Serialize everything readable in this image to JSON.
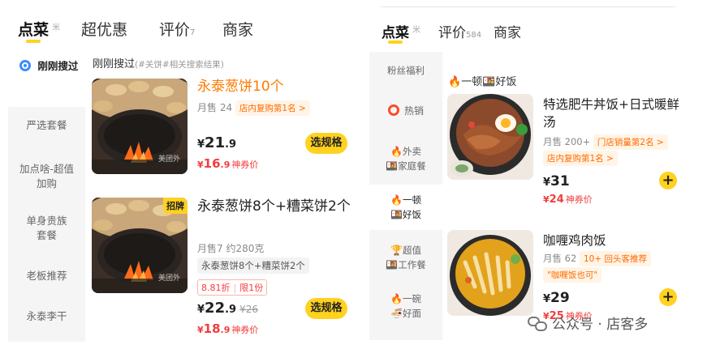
{
  "left": {
    "tabs": [
      {
        "label": "点菜",
        "sup": "米"
      },
      {
        "label": "超优惠"
      },
      {
        "label": "评价",
        "sub": "7"
      },
      {
        "label": "商家"
      }
    ],
    "sidebar": {
      "items": [
        {
          "label": "刚刚搜过",
          "icon": "search-icon"
        },
        {
          "label": "严选套餐"
        },
        {
          "label": "加点啥-超值加购"
        },
        {
          "label": "单身贵族套餐"
        },
        {
          "label": "老板推荐"
        },
        {
          "label": "永泰李干"
        }
      ]
    },
    "section_title": "刚刚搜过",
    "section_hint": "(#关饼#相关搜索结果)",
    "dishes": [
      {
        "title": "永泰葱饼10个",
        "sales": "月售 24",
        "rank_tag": "店内复购第1名 >",
        "price": "21",
        "price_dec": ".9",
        "coupon_price": "16",
        "coupon_dec": ".9",
        "coupon_label": "神券价",
        "button": "选规格",
        "watermark": "美团外"
      },
      {
        "badge": "招牌",
        "title": "永泰葱饼8个+糟菜饼2个",
        "sales": "月售7  约280克",
        "desc_tag": "永泰葱饼8个+糟菜饼2个",
        "discount": "8.81折",
        "limit": "限1份",
        "price": "22",
        "price_dec": ".9",
        "orig_price": "¥26",
        "coupon_price": "18",
        "coupon_dec": ".9",
        "coupon_label": "神券价",
        "button": "选规格",
        "watermark": "美团外"
      }
    ]
  },
  "right": {
    "tabs": [
      {
        "label": "点菜",
        "sup": "米"
      },
      {
        "label": "评价",
        "sub": "584"
      },
      {
        "label": "商家"
      }
    ],
    "sidebar": {
      "items": [
        {
          "label": "粉丝福利"
        },
        {
          "label": "热销",
          "icon": "fire-ring-icon"
        },
        {
          "label": "外卖家庭餐",
          "emoji1": "🔥",
          "emoji2": "🍱"
        },
        {
          "label": "一顿好饭",
          "emoji1": "🔥",
          "emoji2": "🍱"
        },
        {
          "label": "超值工作餐",
          "emoji1": "🏆",
          "emoji2": "🍱"
        },
        {
          "label": "一碗好面",
          "emoji1": "🔥",
          "emoji2": "🍜"
        }
      ]
    },
    "section_title": "一顿好饭",
    "section_emoji1": "🔥",
    "section_emoji2": "🍱",
    "dishes": [
      {
        "title": "特选肥牛丼饭+日式暖鲜汤",
        "sales": "月售 200+",
        "tag1": "门店销量第2名 >",
        "tag2": "店内复购第1名 >",
        "price": "31",
        "coupon_price": "24",
        "coupon_label": "神券价",
        "button": "+"
      },
      {
        "title": "咖喱鸡肉饭",
        "sales": "月售 62",
        "tag1": "10+ 回头客推荐",
        "quote": "\"咖喱饭也可\"",
        "price": "29",
        "coupon_price": "25",
        "coupon_label": "神券价",
        "button": "+"
      }
    ]
  },
  "watermark": {
    "text": "公众号 · 店客多"
  },
  "colors": {
    "accent": "#ffd21f",
    "orange": "#ff7a00",
    "red": "#f23c3c"
  }
}
